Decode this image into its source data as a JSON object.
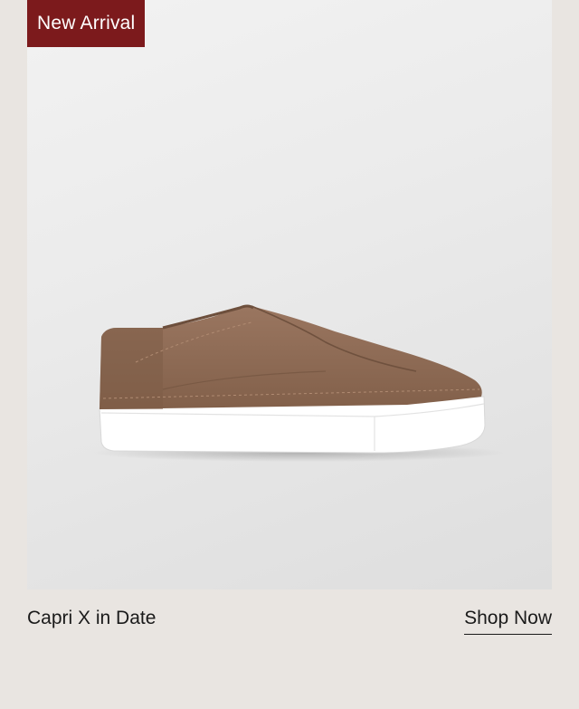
{
  "card": {
    "badge": "New Arrival",
    "product_name": "Capri X in Date",
    "cta_label": "Shop Now",
    "image_subject": "brown suede slip-on sneaker with white sole"
  },
  "colors": {
    "badge_bg": "#7c1a1c",
    "page_bg": "#e9e5e1",
    "suede": "#8f6a52",
    "sole": "#ffffff"
  }
}
